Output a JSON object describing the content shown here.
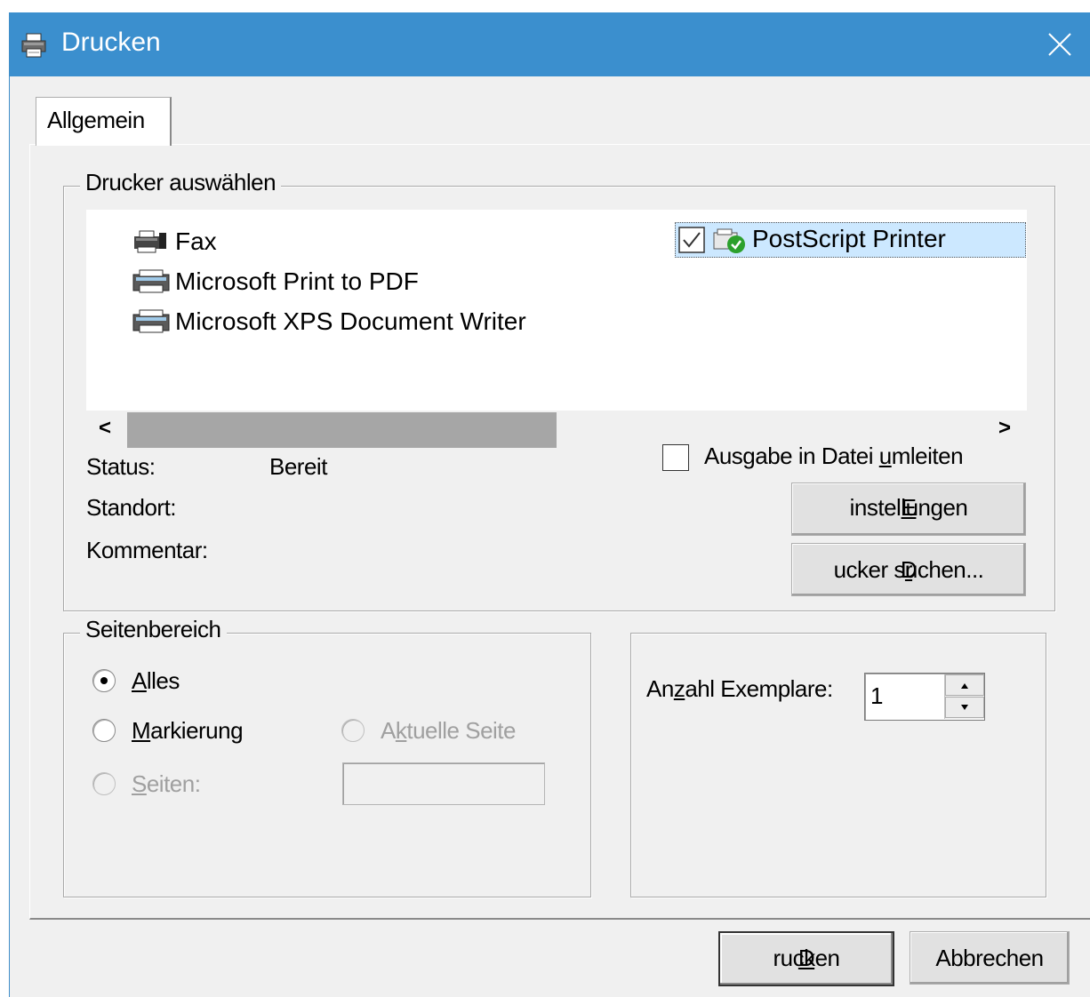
{
  "window": {
    "title": "Drucken",
    "close_icon": "close-icon",
    "title_icon": "printer-icon"
  },
  "tabs": [
    {
      "label": "Allgemein",
      "selected": true
    }
  ],
  "printer_group": {
    "legend": "Drucker auswählen",
    "printers": [
      {
        "name": "Fax",
        "icon": "fax-printer-icon"
      },
      {
        "name": "Microsoft Print to PDF",
        "icon": "printer-icon"
      },
      {
        "name": "Microsoft XPS Document Writer",
        "icon": "printer-icon"
      },
      {
        "name": "PostScript Printer",
        "icon": "default-printer-icon",
        "selected": true,
        "checked": true
      }
    ],
    "scroll_left": "<",
    "scroll_right": ">",
    "status_label": "Status:",
    "status_value": "Bereit",
    "location_label": "Standort:",
    "location_value": "",
    "comment_label": "Kommentar:",
    "comment_value": "",
    "print_to_file": {
      "label_pre": "Ausgabe in Datei ",
      "label_key": "u",
      "label_post": "mleiten",
      "checked": false
    },
    "settings_button": {
      "key": "E",
      "rest": "instellungen"
    },
    "find_printer_button": {
      "pre": "D",
      "key": "r",
      "post": "ucker suchen..."
    }
  },
  "page_range_group": {
    "legend": "Seitenbereich",
    "all": {
      "key": "A",
      "rest": "lles",
      "checked": true
    },
    "selection": {
      "key": "M",
      "rest": "arkierung",
      "checked": false
    },
    "current_page": {
      "pre": "A",
      "key": "k",
      "post": "tuelle Seite",
      "enabled": false
    },
    "pages": {
      "key": "S",
      "rest": "eiten:",
      "enabled": false
    },
    "pages_value": ""
  },
  "copies_group": {
    "label_pre": "An",
    "label_key": "z",
    "label_post": "ahl Exemplare:",
    "value": "1"
  },
  "buttons": {
    "print": {
      "key": "D",
      "rest": "rucken"
    },
    "cancel": "Abbrechen"
  },
  "colors": {
    "titlebar": "#3b8fce",
    "dialog_bg": "#f0f0f0",
    "selection": "#cce8ff",
    "status_ok": "#2ca02c"
  }
}
